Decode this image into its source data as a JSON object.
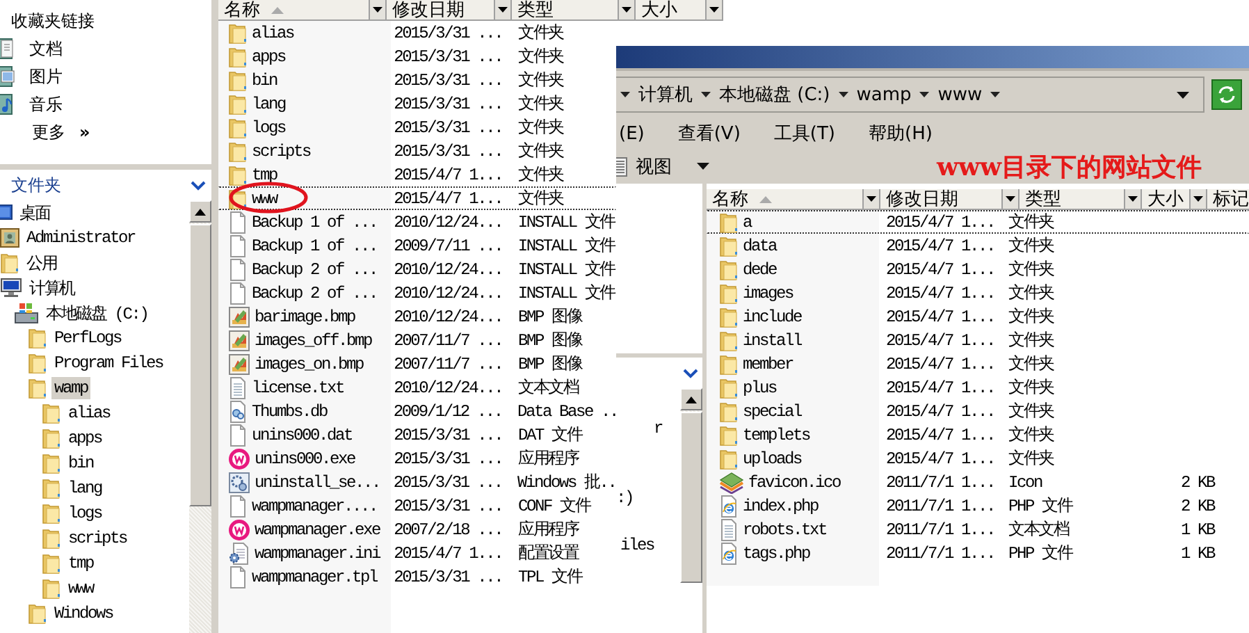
{
  "favorites": {
    "title": "收藏夹链接",
    "links": [
      {
        "kind": "documents",
        "label": "文档"
      },
      {
        "kind": "pictures",
        "label": "图片"
      },
      {
        "kind": "music",
        "label": "音乐"
      }
    ],
    "more": {
      "label": "更多",
      "chevron": "»"
    }
  },
  "folders_pane": {
    "title": "文件夹",
    "tree": [
      {
        "kind": "desktop",
        "label": "桌面",
        "selected": false,
        "children": [
          {
            "kind": "user",
            "label": "Administrator",
            "selected": false
          },
          {
            "kind": "folder",
            "label": "公用",
            "selected": false
          },
          {
            "kind": "computer",
            "label": "计算机",
            "selected": false,
            "children": [
              {
                "kind": "drive",
                "label": "本地磁盘 (C:)",
                "selected": false,
                "children": [
                  {
                    "kind": "folder",
                    "label": "PerfLogs",
                    "selected": false
                  },
                  {
                    "kind": "folder",
                    "label": "Program Files",
                    "selected": false
                  },
                  {
                    "kind": "folder",
                    "label": "wamp",
                    "selected": true,
                    "children": [
                      {
                        "kind": "folder",
                        "label": "alias",
                        "selected": false
                      },
                      {
                        "kind": "folder",
                        "label": "apps",
                        "selected": false
                      },
                      {
                        "kind": "folder",
                        "label": "bin",
                        "selected": false
                      },
                      {
                        "kind": "folder",
                        "label": "lang",
                        "selected": false
                      },
                      {
                        "kind": "folder",
                        "label": "logs",
                        "selected": false
                      },
                      {
                        "kind": "folder",
                        "label": "scripts",
                        "selected": false
                      },
                      {
                        "kind": "folder",
                        "label": "tmp",
                        "selected": false
                      },
                      {
                        "kind": "folder",
                        "label": "www",
                        "selected": false
                      }
                    ]
                  },
                  {
                    "kind": "folder",
                    "label": "Windows",
                    "selected": false
                  }
                ]
              }
            ]
          }
        ]
      }
    ]
  },
  "explorer_list": {
    "columns": [
      {
        "label": "名称",
        "sorted": true
      },
      {
        "label": "修改日期",
        "sorted": false
      },
      {
        "label": "类型",
        "sorted": false
      },
      {
        "label": "大小",
        "sorted": false
      }
    ],
    "rows": [
      {
        "kind": "folder",
        "name": "alias",
        "date": "2015/3/31 ...",
        "type": "文件夹",
        "focused": false,
        "circled": false
      },
      {
        "kind": "folder",
        "name": "apps",
        "date": "2015/3/31 ...",
        "type": "文件夹",
        "focused": false,
        "circled": false
      },
      {
        "kind": "folder",
        "name": "bin",
        "date": "2015/3/31 ...",
        "type": "文件夹",
        "focused": false,
        "circled": false
      },
      {
        "kind": "folder",
        "name": "lang",
        "date": "2015/3/31 ...",
        "type": "文件夹",
        "focused": false,
        "circled": false
      },
      {
        "kind": "folder",
        "name": "logs",
        "date": "2015/3/31 ...",
        "type": "文件夹",
        "focused": false,
        "circled": false
      },
      {
        "kind": "folder",
        "name": "scripts",
        "date": "2015/3/31 ...",
        "type": "文件夹",
        "focused": false,
        "circled": false
      },
      {
        "kind": "folder",
        "name": "tmp",
        "date": "2015/4/7 1...",
        "type": "文件夹",
        "focused": false,
        "circled": false
      },
      {
        "kind": "folder",
        "name": "www",
        "date": "2015/4/7 1...",
        "type": "文件夹",
        "focused": true,
        "circled": true
      },
      {
        "kind": "file",
        "name": "Backup 1 of ...",
        "date": "2010/12/24...",
        "type": "INSTALL 文件",
        "focused": false,
        "circled": false
      },
      {
        "kind": "file",
        "name": "Backup 1 of ...",
        "date": "2009/7/11 ...",
        "type": "INSTALL 文件",
        "focused": false,
        "circled": false
      },
      {
        "kind": "file",
        "name": "Backup 2 of ...",
        "date": "2010/12/24...",
        "type": "INSTALL 文件",
        "focused": false,
        "circled": false
      },
      {
        "kind": "file",
        "name": "Backup 2 of ...",
        "date": "2010/12/24...",
        "type": "INSTALL 文件",
        "focused": false,
        "circled": false
      },
      {
        "kind": "bmp",
        "name": "barimage.bmp",
        "date": "2010/12/24...",
        "type": "BMP 图像",
        "focused": false,
        "circled": false
      },
      {
        "kind": "bmp",
        "name": "images_off.bmp",
        "date": "2007/11/7 ...",
        "type": "BMP 图像",
        "focused": false,
        "circled": false
      },
      {
        "kind": "bmp",
        "name": "images_on.bmp",
        "date": "2007/11/7 ...",
        "type": "BMP 图像",
        "focused": false,
        "circled": false
      },
      {
        "kind": "txt",
        "name": "license.txt",
        "date": "2010/12/24...",
        "type": "文本文档",
        "focused": false,
        "circled": false
      },
      {
        "kind": "db",
        "name": "Thumbs.db",
        "date": "2009/1/12 ...",
        "type": "Data Base ..",
        "focused": false,
        "circled": false
      },
      {
        "kind": "file",
        "name": "unins000.dat",
        "date": "2015/3/31 ...",
        "type": "DAT 文件",
        "focused": false,
        "circled": false
      },
      {
        "kind": "exe",
        "name": "unins000.exe",
        "date": "2015/3/31 ...",
        "type": "应用程序",
        "focused": false,
        "circled": false
      },
      {
        "kind": "bat",
        "name": "uninstall_se...",
        "date": "2015/3/31 ...",
        "type": "Windows 批..",
        "focused": false,
        "circled": false
      },
      {
        "kind": "file",
        "name": "wampmanager....",
        "date": "2015/3/31 ...",
        "type": "CONF 文件",
        "focused": false,
        "circled": false
      },
      {
        "kind": "exe",
        "name": "wampmanager.exe",
        "date": "2007/2/18 ...",
        "type": "应用程序",
        "focused": false,
        "circled": false
      },
      {
        "kind": "ini",
        "name": "wampmanager.ini",
        "date": "2015/4/7 1...",
        "type": "配置设置",
        "focused": false,
        "circled": false
      },
      {
        "kind": "file",
        "name": "wampmanager.tpl",
        "date": "2015/3/31 ...",
        "type": "TPL 文件",
        "focused": false,
        "circled": false
      }
    ]
  },
  "www_window": {
    "address_bar": {
      "crumbs": [
        "计算机",
        "本地磁盘 (C:)",
        "wamp",
        "www"
      ]
    },
    "menu": [
      "(E)",
      "查看(V)",
      "工具(T)",
      "帮助(H)"
    ],
    "toolbar": {
      "views": "视图"
    },
    "annotation": "www目录下的网站文件",
    "navigation_pane_fragments": [
      "r",
      ":)",
      "iles"
    ],
    "file_list": {
      "columns": [
        {
          "label": "名称",
          "sorted": true
        },
        {
          "label": "修改日期",
          "sorted": false
        },
        {
          "label": "类型",
          "sorted": false
        },
        {
          "label": "大小"
        },
        {
          "label": "标记"
        }
      ],
      "rows": [
        {
          "kind": "folder",
          "name": "a",
          "date": "2015/4/7 1...",
          "type": "文件夹",
          "focused": true
        },
        {
          "kind": "folder",
          "name": "data",
          "date": "2015/4/7 1...",
          "type": "文件夹",
          "focused": false
        },
        {
          "kind": "folder",
          "name": "dede",
          "date": "2015/4/7 1...",
          "type": "文件夹",
          "focused": false
        },
        {
          "kind": "folder",
          "name": "images",
          "date": "2015/4/7 1...",
          "type": "文件夹",
          "focused": false
        },
        {
          "kind": "folder",
          "name": "include",
          "date": "2015/4/7 1...",
          "type": "文件夹",
          "focused": false
        },
        {
          "kind": "folder",
          "name": "install",
          "date": "2015/4/7 1...",
          "type": "文件夹",
          "focused": false
        },
        {
          "kind": "folder",
          "name": "member",
          "date": "2015/4/7 1...",
          "type": "文件夹",
          "focused": false
        },
        {
          "kind": "folder",
          "name": "plus",
          "date": "2015/4/7 1...",
          "type": "文件夹",
          "focused": false
        },
        {
          "kind": "folder",
          "name": "special",
          "date": "2015/4/7 1...",
          "type": "文件夹",
          "focused": false
        },
        {
          "kind": "folder",
          "name": "templets",
          "date": "2015/4/7 1...",
          "type": "文件夹",
          "focused": false
        },
        {
          "kind": "folder",
          "name": "uploads",
          "date": "2015/4/7 1...",
          "type": "文件夹",
          "focused": false
        },
        {
          "kind": "ico",
          "name": "favicon.ico",
          "date": "2011/7/1 1...",
          "type": "Icon",
          "size": "2 KB",
          "focused": false
        },
        {
          "kind": "php",
          "name": "index.php",
          "date": "2011/7/1 1...",
          "type": "PHP 文件",
          "size": "2 KB",
          "focused": false
        },
        {
          "kind": "txt",
          "name": "robots.txt",
          "date": "2011/7/1 1...",
          "type": "文本文档",
          "size": "1 KB",
          "focused": false
        },
        {
          "kind": "php",
          "name": "tags.php",
          "date": "2011/7/1 1...",
          "type": "PHP 文件",
          "size": "1 KB",
          "focused": false
        }
      ]
    }
  }
}
